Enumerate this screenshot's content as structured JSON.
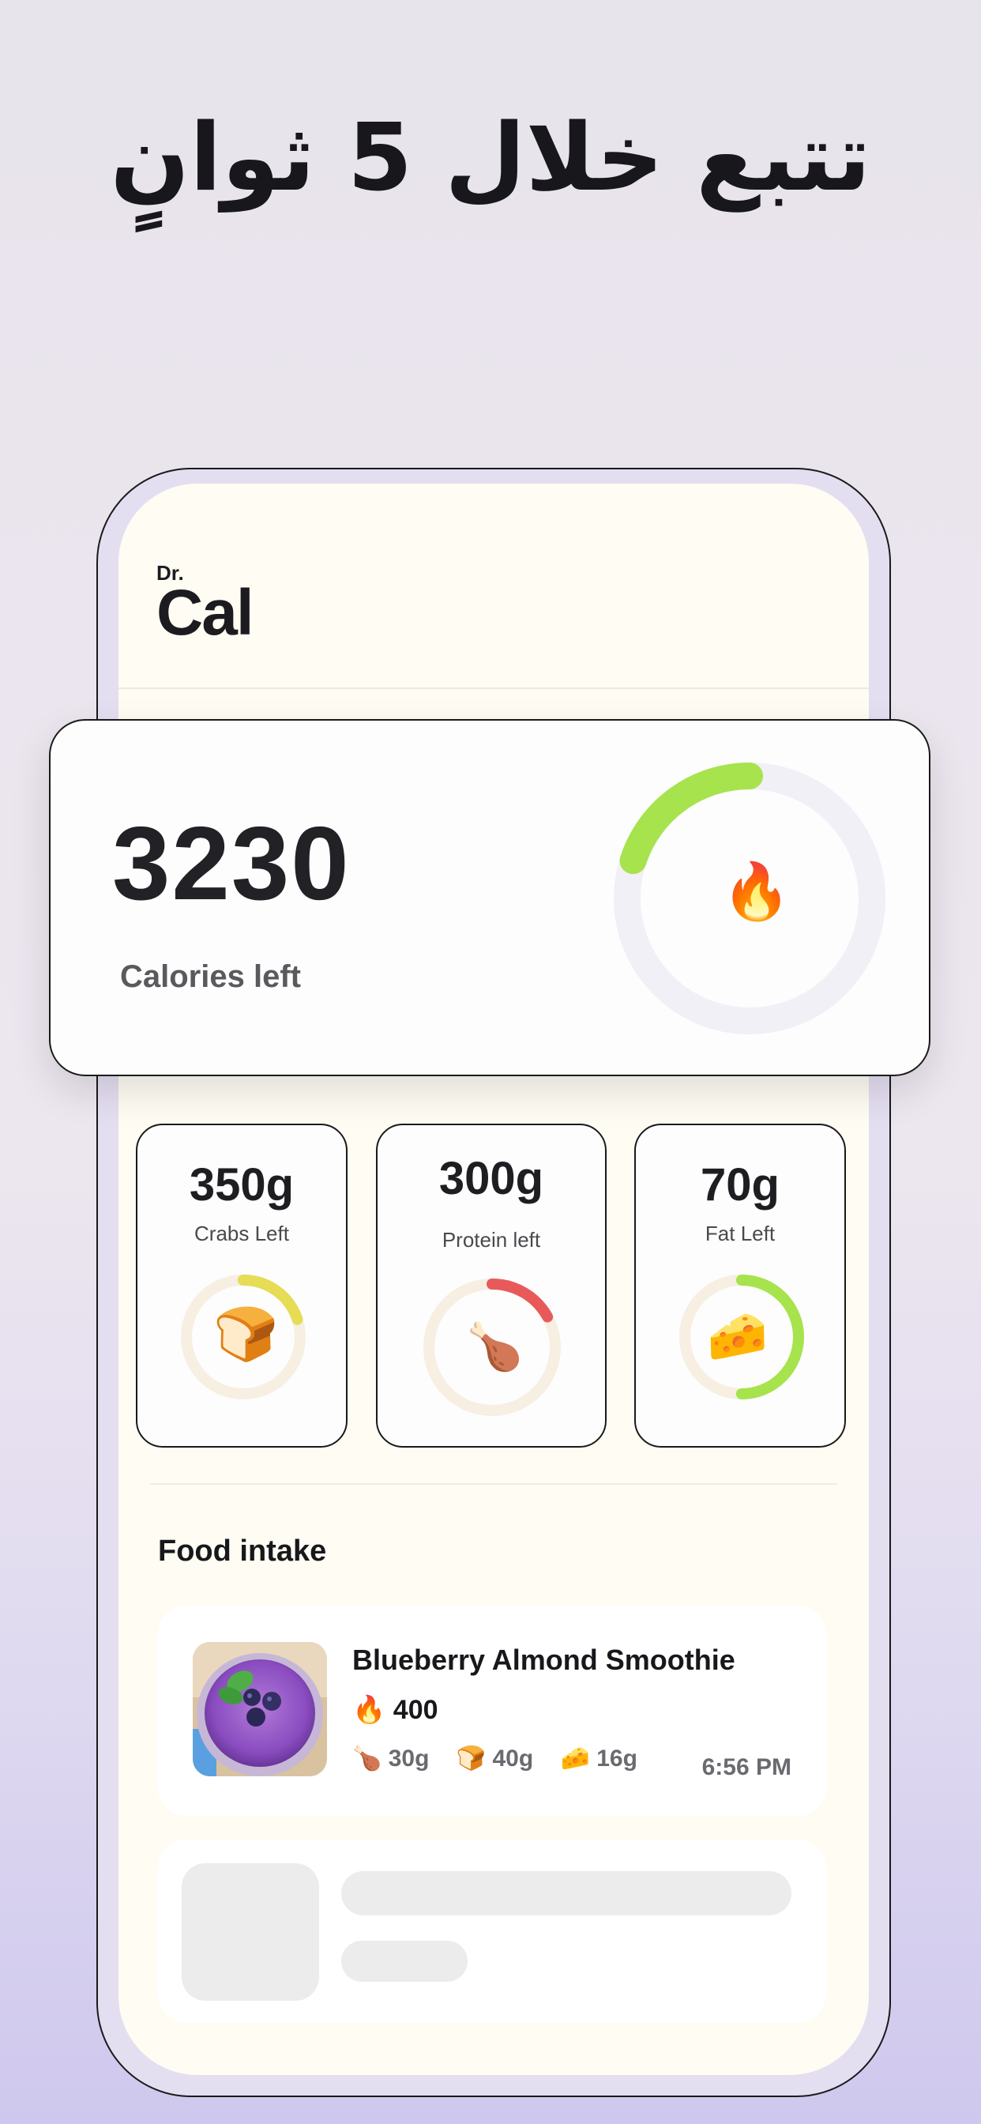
{
  "headline": "تتبع خلال 5 ثوانٍ",
  "app": {
    "logo_small": "Dr.",
    "logo_large": "Cal"
  },
  "calories": {
    "value": "3230",
    "label": "Calories left",
    "icon": "fire-icon",
    "progress": 0.2,
    "color": "#a6e34d"
  },
  "macros": [
    {
      "value": "350g",
      "label": "Crabs Left",
      "icon": "bread-icon",
      "color": "#e6dc55",
      "progress": 0.2
    },
    {
      "value": "300g",
      "label": "Protein left",
      "icon": "drumstick-icon",
      "color": "#e85a5a",
      "progress": 0.17
    },
    {
      "value": "70g",
      "label": "Fat Left",
      "icon": "cheese-icon",
      "color": "#a6e34d",
      "progress": 0.5
    }
  ],
  "food_intake": {
    "title": "Food intake",
    "items": [
      {
        "name": "Blueberry Almond Smoothie",
        "calories": "400",
        "protein": "30g",
        "carbs": "40g",
        "fat": "16g",
        "time": "6:56 PM"
      }
    ]
  }
}
